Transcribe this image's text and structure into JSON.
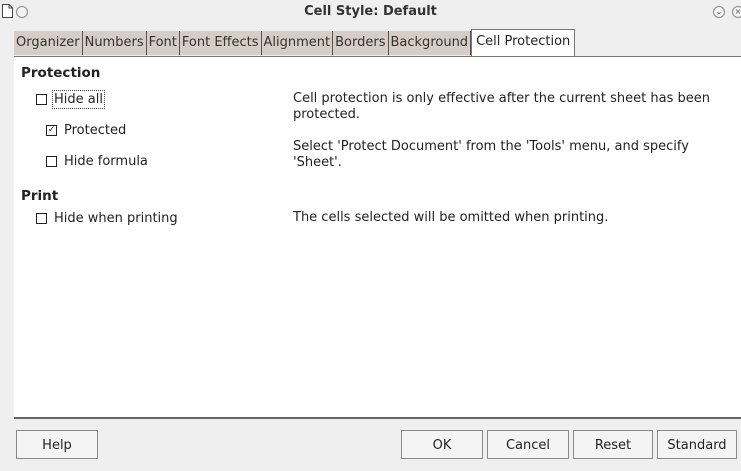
{
  "window": {
    "title": "Cell Style: Default"
  },
  "tabs": [
    {
      "label": "Organizer"
    },
    {
      "label": "Numbers"
    },
    {
      "label": "Font"
    },
    {
      "label": "Font Effects"
    },
    {
      "label": "Alignment"
    },
    {
      "label": "Borders"
    },
    {
      "label": "Background"
    },
    {
      "label": "Cell Protection"
    }
  ],
  "active_tab": "Cell Protection",
  "protection": {
    "title": "Protection",
    "hide_all": {
      "label": "Hide all",
      "checked": false
    },
    "protected": {
      "label": "Protected",
      "checked": true
    },
    "hide_formula": {
      "label": "Hide formula",
      "checked": false
    },
    "note1": "Cell protection is only effective after the current sheet has been protected.",
    "note2": "Select 'Protect Document' from the 'Tools' menu, and specify 'Sheet'."
  },
  "print": {
    "title": "Print",
    "hide_when_printing": {
      "label": "Hide when printing",
      "checked": false
    },
    "note": "The cells selected will be omitted when printing."
  },
  "buttons": {
    "help": "Help",
    "ok": "OK",
    "cancel": "Cancel",
    "reset": "Reset",
    "standard": "Standard"
  }
}
